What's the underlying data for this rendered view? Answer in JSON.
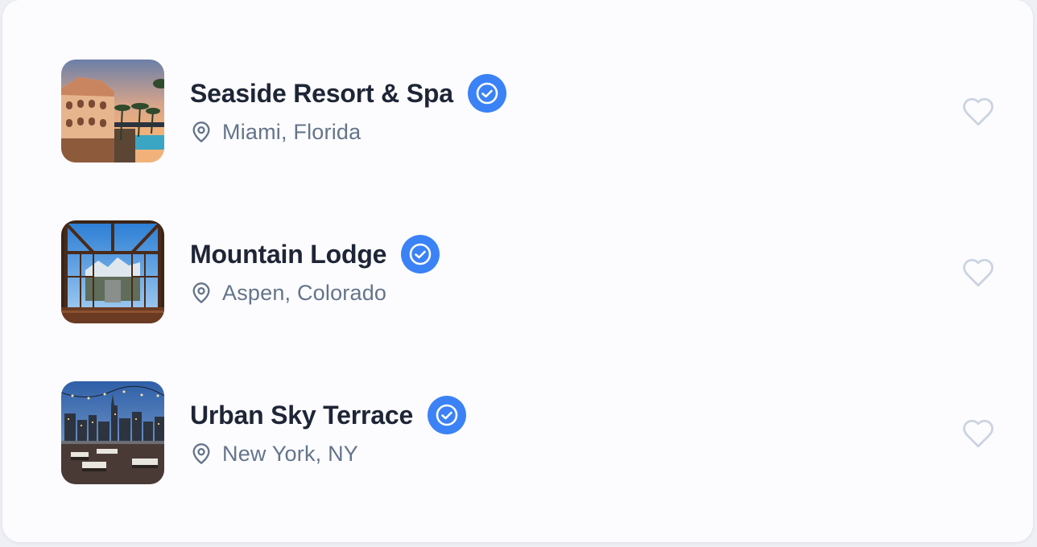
{
  "colors": {
    "card_bg": "#fcfcfe",
    "title": "#1e2536",
    "location": "#64748b",
    "verified_bg": "#3b82f6",
    "heart_stroke": "#cbd3e1"
  },
  "listings": [
    {
      "name": "Seaside Resort & Spa",
      "location": "Miami, Florida",
      "verified": true,
      "favorited": false,
      "image": "seaside-resort-photo"
    },
    {
      "name": "Mountain Lodge",
      "location": "Aspen, Colorado",
      "verified": true,
      "favorited": false,
      "image": "mountain-lodge-photo"
    },
    {
      "name": "Urban Sky Terrace",
      "location": "New York, NY",
      "verified": true,
      "favorited": false,
      "image": "rooftop-terrace-photo"
    }
  ],
  "icons": {
    "verified": "check-circle-icon",
    "location": "map-pin-icon",
    "favorite": "heart-outline-icon"
  }
}
